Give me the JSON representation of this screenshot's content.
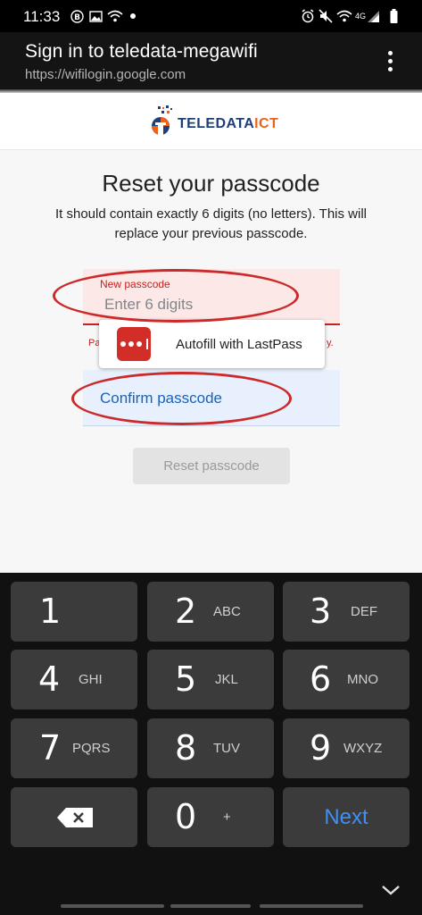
{
  "status_bar": {
    "time": "11:33",
    "icons": [
      "b-badge-icon",
      "gallery-icon",
      "wifi-icon",
      "dot-icon",
      "alarm-icon",
      "mute-icon",
      "wifi-icon",
      "4g-signal-icon",
      "battery-icon"
    ],
    "network_label": "4G"
  },
  "browser": {
    "title": "Sign in to teledata-megawifi",
    "url": "https://wifilogin.google.com",
    "menu_icon": "more-vert-icon"
  },
  "logo": {
    "text_part1": "TELEDATA",
    "text_part2": "ICT",
    "color_primary": "#1f3f7a",
    "color_accent": "#e8641c"
  },
  "form": {
    "heading": "Reset your passcode",
    "instructions": "It should contain exactly 6 digits (no letters). This will replace your previous passcode.",
    "new_passcode": {
      "label": "New passcode",
      "placeholder": "Enter 6 digits",
      "error_fragment_left": "Pa",
      "error_fragment_right": "y."
    },
    "confirm_passcode": {
      "label": "Confirm passcode"
    },
    "submit_label": "Reset passcode"
  },
  "autofill": {
    "label": "Autofill with LastPass",
    "icon": "lastpass-icon",
    "brand_color": "#d32d27"
  },
  "keyboard": {
    "keys": [
      {
        "digit": "1",
        "letters": ""
      },
      {
        "digit": "2",
        "letters": "ABC"
      },
      {
        "digit": "3",
        "letters": "DEF"
      },
      {
        "digit": "4",
        "letters": "GHI"
      },
      {
        "digit": "5",
        "letters": "JKL"
      },
      {
        "digit": "6",
        "letters": "MNO"
      },
      {
        "digit": "7",
        "letters": "PQRS"
      },
      {
        "digit": "8",
        "letters": "TUV"
      },
      {
        "digit": "9",
        "letters": "WXYZ"
      },
      {
        "digit": "0",
        "letters": "+"
      }
    ],
    "next_label": "Next",
    "next_color": "#3f8ff7",
    "backspace_icon": "backspace-icon",
    "hide_icon": "chevron-down-icon"
  },
  "annotation_color": "#cc2a2a"
}
